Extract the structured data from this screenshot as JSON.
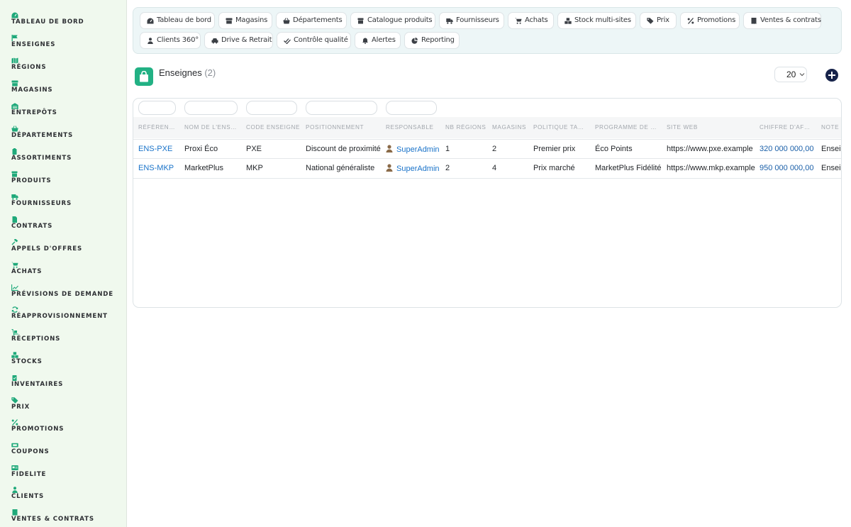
{
  "sidebar": {
    "items": [
      {
        "label": "TABLEAU DE BORD",
        "icon": "dashboard-icon"
      },
      {
        "label": "ENSEIGNES",
        "icon": "flag-icon"
      },
      {
        "label": "RÉGIONS",
        "icon": "map-icon"
      },
      {
        "label": "MAGASINS",
        "icon": "store-icon"
      },
      {
        "label": "ENTREPÔTS",
        "icon": "warehouse-icon"
      },
      {
        "label": "DÉPARTEMENTS",
        "icon": "basket-icon"
      },
      {
        "label": "ASSORTIMENTS",
        "icon": "clipboard-icon"
      },
      {
        "label": "PRODUITS",
        "icon": "box-icon"
      },
      {
        "label": "FOURNISSEURS",
        "icon": "truck-icon"
      },
      {
        "label": "CONTRATS",
        "icon": "document-icon"
      },
      {
        "label": "APPELS D'OFFRES",
        "icon": "gavel-icon"
      },
      {
        "label": "ACHATS",
        "icon": "cart-icon"
      },
      {
        "label": "PRÉVISIONS DE DEMANDE",
        "icon": "chart-line-icon"
      },
      {
        "label": "RÉAPPROVISIONNEMENT",
        "icon": "refresh-icon"
      },
      {
        "label": "RÉCEPTIONS",
        "icon": "dolly-icon"
      },
      {
        "label": "STOCKS",
        "icon": "boxes-icon"
      },
      {
        "label": "INVENTAIRES",
        "icon": "clipboard-check-icon"
      },
      {
        "label": "PRIX",
        "icon": "tags-icon"
      },
      {
        "label": "PROMOTIONS",
        "icon": "percent-icon"
      },
      {
        "label": "COUPONS",
        "icon": "ticket-icon"
      },
      {
        "label": "FIDELITE",
        "icon": "loyalty-card-icon"
      },
      {
        "label": "CLIENTS",
        "icon": "user-icon"
      },
      {
        "label": "VENTES & CONTRATS",
        "icon": "receipt-icon"
      }
    ]
  },
  "topnav": {
    "chips": [
      {
        "label": "Tableau de bord",
        "icon": "dashboard-icon"
      },
      {
        "label": "Magasins",
        "icon": "store-icon"
      },
      {
        "label": "Départements",
        "icon": "basket-icon"
      },
      {
        "label": "Catalogue produits",
        "icon": "box-icon"
      },
      {
        "label": "Fournisseurs",
        "icon": "truck-icon"
      },
      {
        "label": "Achats",
        "icon": "cart-icon"
      },
      {
        "label": "Stock multi-sites",
        "icon": "boxes-icon"
      },
      {
        "label": "Prix",
        "icon": "tags-icon"
      },
      {
        "label": "Promotions",
        "icon": "percent-icon"
      },
      {
        "label": "Ventes & contrats",
        "icon": "receipt-icon"
      },
      {
        "label": "Clients 360°",
        "icon": "user-icon"
      },
      {
        "label": "Drive & Retrait",
        "icon": "car-icon"
      },
      {
        "label": "Contrôle qualité",
        "icon": "check-double-icon"
      },
      {
        "label": "Alertes",
        "icon": "bell-icon"
      },
      {
        "label": "Reporting",
        "icon": "pie-chart-icon"
      }
    ]
  },
  "header": {
    "title": "Enseignes",
    "count": "(2)",
    "icon": "shopping-bag-icon",
    "page_size": "20",
    "accent_color": "#22b184"
  },
  "table": {
    "columns": [
      "RÉFÉRENCE",
      "NOM DE L'ENSEIGNE",
      "CODE ENSEIGNE",
      "POSITIONNEMENT",
      "RESPONSABLE",
      "NB RÉGIONS",
      "MAGASINS",
      "POLITIQUE TARIFAIRE",
      "PROGRAMME DE FIDÉLITÉ",
      "SITE WEB",
      "CHIFFRE D'AFFAIRES",
      "NOTE"
    ],
    "rows": [
      {
        "reference": "ENS-PXE",
        "nom": "Proxi Éco",
        "code": "PXE",
        "positionnement": "Discount de proximité",
        "responsable": "SuperAdmin",
        "nb_regions": "1",
        "magasins": "2",
        "politique": "Premier prix",
        "programme": "Éco Points",
        "site": "https://www.pxe.example",
        "ca": "320 000 000,00",
        "note": "Enseig"
      },
      {
        "reference": "ENS-MKP",
        "nom": "MarketPlus",
        "code": "MKP",
        "positionnement": "National généraliste",
        "responsable": "SuperAdmin",
        "nb_regions": "2",
        "magasins": "4",
        "politique": "Prix marché",
        "programme": "MarketPlus Fidélité",
        "site": "https://www.mkp.example",
        "ca": "950 000 000,00",
        "note": "Enseig"
      }
    ]
  }
}
